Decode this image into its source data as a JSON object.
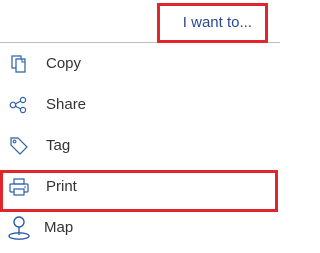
{
  "header": {
    "action_label": "I want to..."
  },
  "menu": {
    "items": [
      {
        "label": "Copy",
        "icon": "copy-icon"
      },
      {
        "label": "Share",
        "icon": "share-icon"
      },
      {
        "label": "Tag",
        "icon": "tag-icon"
      },
      {
        "label": "Print",
        "icon": "printer-icon"
      },
      {
        "label": "Map",
        "icon": "map-pin-icon"
      }
    ]
  },
  "colors": {
    "highlight": "#e0252b",
    "action_text": "#2a4a8c",
    "icon": "#2a5fa8",
    "text": "#333333",
    "divider": "#bfbfbf"
  }
}
